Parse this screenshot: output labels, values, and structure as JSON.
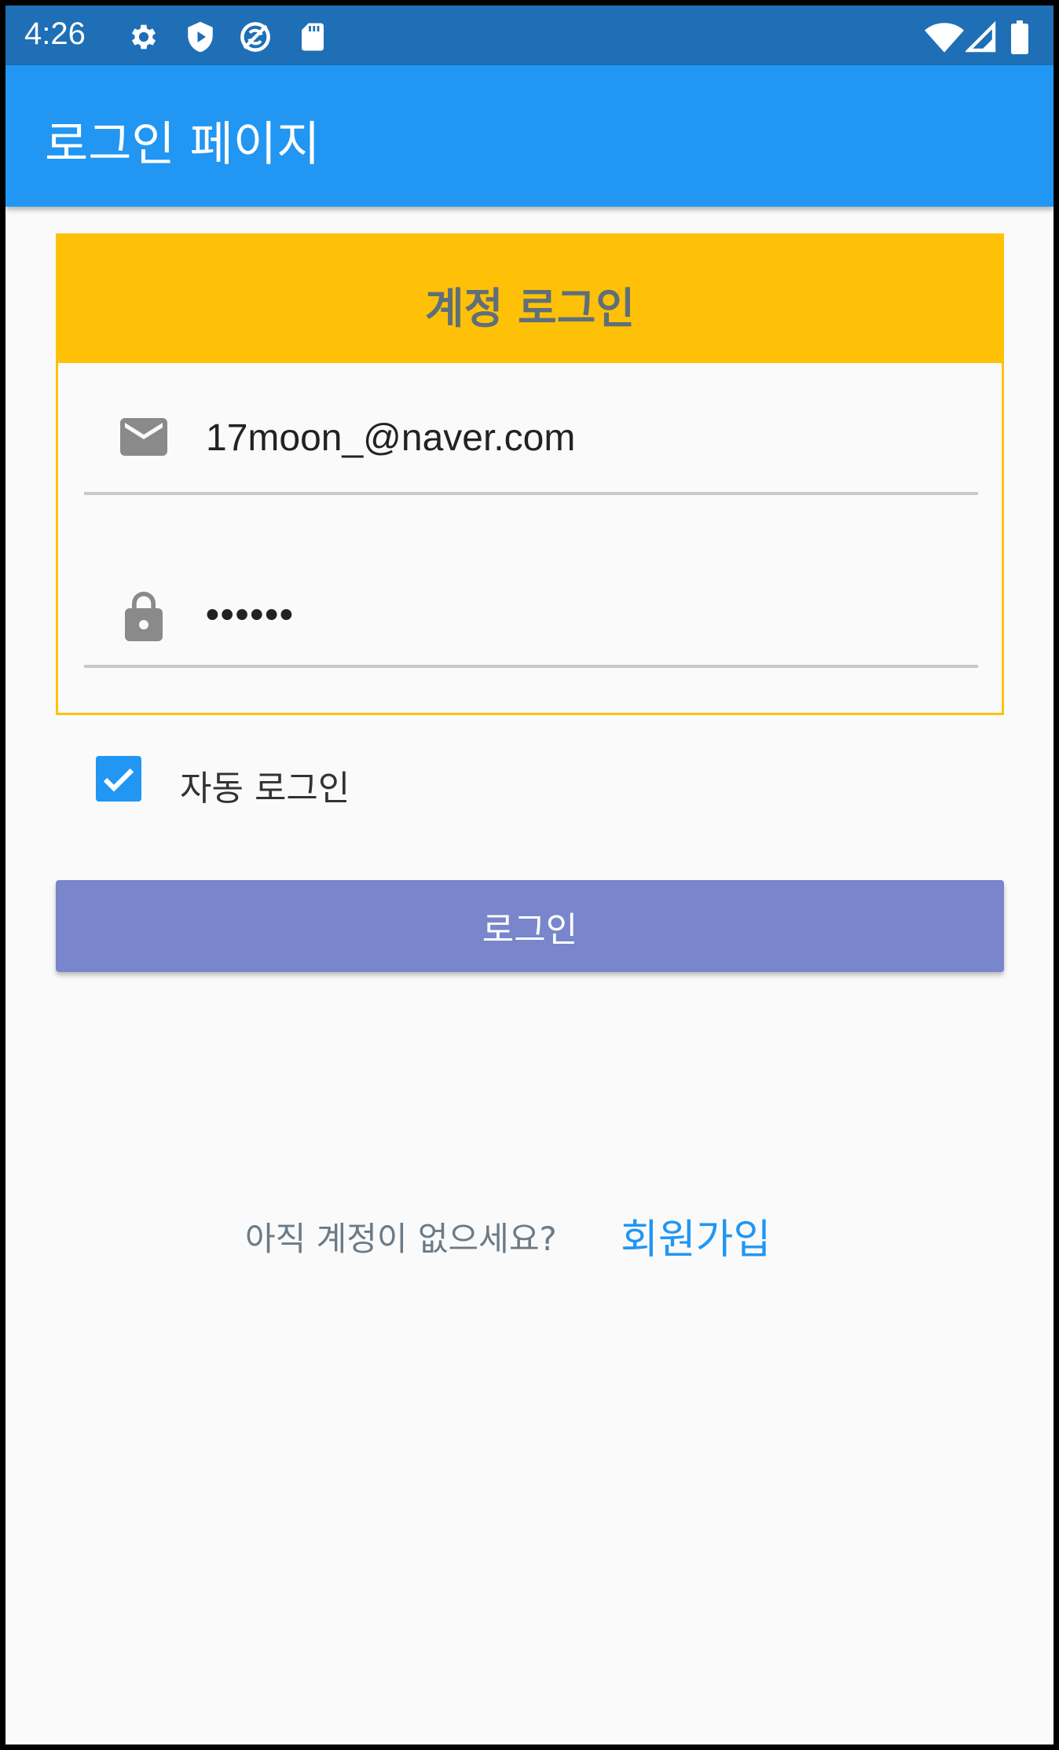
{
  "status_bar": {
    "time": "4:26",
    "left_icons": [
      "gear-icon",
      "shield-icon",
      "sync-circle-icon",
      "sd-card-icon"
    ],
    "right_icons": [
      "wifi-icon",
      "signal-icon",
      "battery-icon"
    ]
  },
  "app_bar": {
    "title": "로그인 페이지",
    "color": "#2196f3"
  },
  "login_card": {
    "title": "계정 로그인",
    "accent_color": "#ffc107",
    "email": {
      "icon": "mail-icon",
      "value": "17moon_@naver.com"
    },
    "password": {
      "icon": "lock-icon",
      "value": "••••••"
    }
  },
  "auto_login": {
    "label": "자동 로그인",
    "checked": true
  },
  "login_button": {
    "label": "로그인",
    "color": "#7986cb"
  },
  "signup": {
    "prompt": "아직 계정이 없으세요?",
    "link_label": "회원가입"
  }
}
